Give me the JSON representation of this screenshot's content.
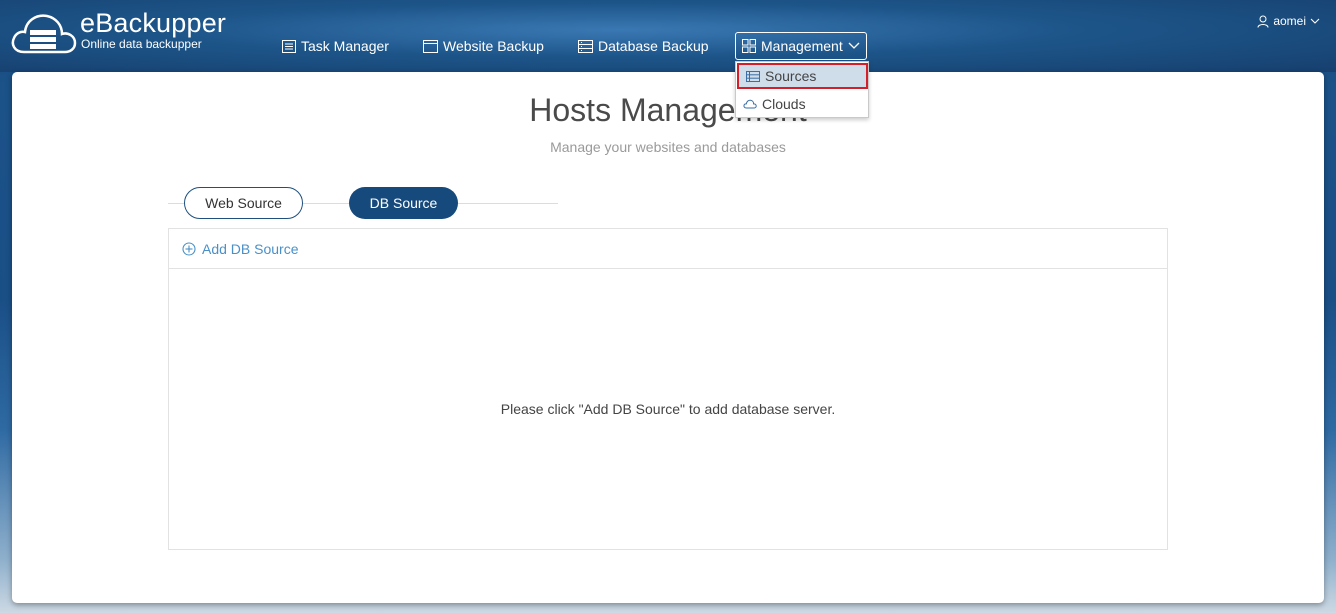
{
  "brand": {
    "name": "eBackupper",
    "tagline": "Online data backupper"
  },
  "nav": {
    "task_manager": "Task Manager",
    "website_backup": "Website Backup",
    "database_backup": "Database Backup",
    "management": "Management"
  },
  "user": {
    "name": "aomei"
  },
  "dropdown": {
    "sources": "Sources",
    "clouds": "Clouds"
  },
  "page": {
    "title": "Hosts Management",
    "subtitle": "Manage your websites and databases"
  },
  "tabs": {
    "web_source": "Web Source",
    "db_source": "DB Source",
    "active": "DB Source"
  },
  "db_panel": {
    "add_label": "Add DB Source",
    "empty_message": "Please click \"Add DB Source\" to add database server."
  },
  "colors": {
    "header_blue": "#174a7c",
    "link_blue": "#4a90c8",
    "highlight_red": "#d21f2a",
    "selected_bg": "#cfdcea"
  }
}
